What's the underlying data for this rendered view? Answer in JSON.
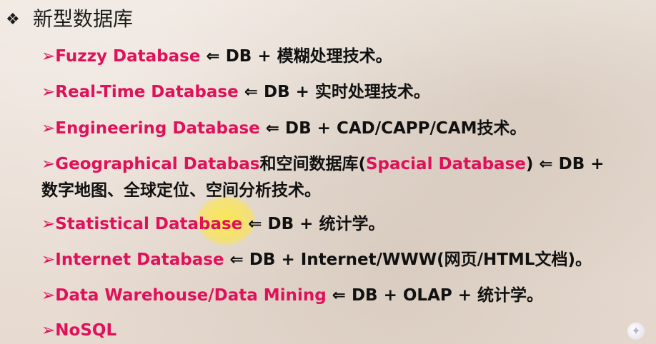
{
  "title": {
    "bullet": "❖",
    "text": "新型数据库"
  },
  "arrow": "➢",
  "items": [
    {
      "name": "Fuzzy Database",
      "rest": " ⇐ DB + 模糊处理技术。"
    },
    {
      "name": "Real-Time Database",
      "rest": " ⇐ DB + 实时处理技术。"
    },
    {
      "name": "Engineering Database",
      "rest": " ⇐ DB + CAD/CAPP/CAM技术。"
    },
    {
      "name": "Geographical Databas",
      "middle": "和空间数据库(",
      "name2": "Spacial Database",
      "rest": ") ⇐ DB +",
      "continuation": "数字地图、全球定位、空间分析技术。"
    },
    {
      "name": "Statistical Database",
      "rest": " ⇐ DB + 统计学。"
    },
    {
      "name": "Internet Database",
      "rest": " ⇐ DB + Internet/WWW(网页/HTML文档)。"
    },
    {
      "name": "Data Warehouse/Data Mining",
      "rest": " ⇐ DB + OLAP + 统计学。"
    },
    {
      "name": "NoSQL",
      "rest": ""
    }
  ],
  "corner_icon": "star-icon"
}
